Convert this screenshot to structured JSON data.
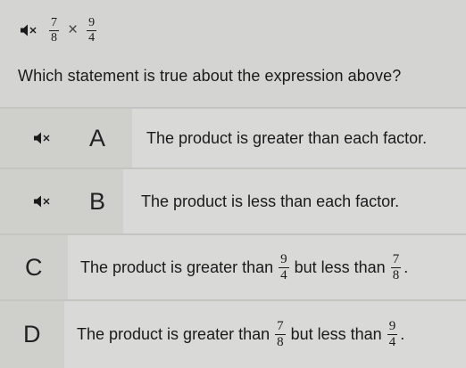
{
  "expression": {
    "left": {
      "numerator": "7",
      "denominator": "8"
    },
    "operator": "×",
    "right": {
      "numerator": "9",
      "denominator": "4"
    },
    "speaker_icon": "speaker-mute-icon"
  },
  "question": "Which statement is true about the expression above?",
  "options": [
    {
      "letter": "A",
      "text": "The product is greater than each factor.",
      "speaker_icon": "speaker-mute-icon"
    },
    {
      "letter": "B",
      "text": "The product is less than each factor.",
      "speaker_icon": "speaker-mute-icon"
    },
    {
      "letter": "C",
      "text_before": "The product is greater than",
      "frac1": {
        "numerator": "9",
        "denominator": "4"
      },
      "text_middle": "but less than",
      "frac2": {
        "numerator": "7",
        "denominator": "8"
      },
      "text_after": "."
    },
    {
      "letter": "D",
      "text_before": "The product is greater than",
      "frac1": {
        "numerator": "7",
        "denominator": "8"
      },
      "text_middle": "but less than",
      "frac2": {
        "numerator": "9",
        "denominator": "4"
      },
      "text_after": "."
    }
  ]
}
